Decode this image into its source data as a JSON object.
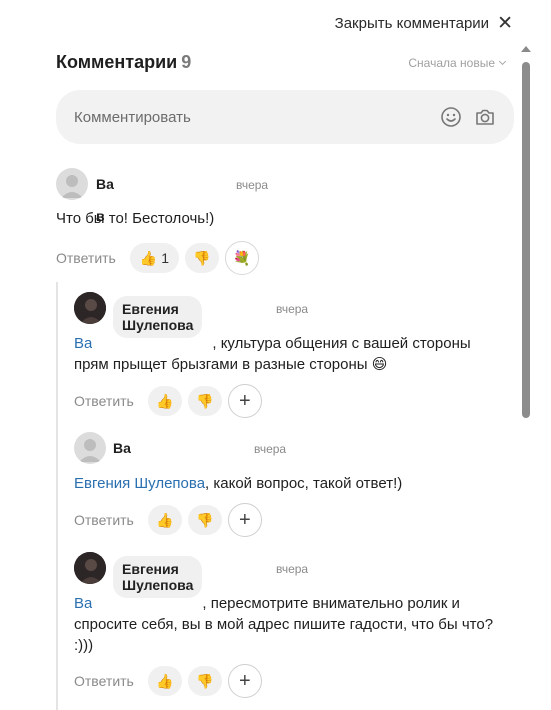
{
  "close_label": "Закрыть комментарии",
  "header": {
    "title": "Комментарии",
    "count": "9",
    "sort_label": "Сначала новые"
  },
  "composer": {
    "placeholder": "Комментировать"
  },
  "comments": [
    {
      "author": "Ва",
      "author_tail": "в",
      "time": "вчера",
      "text": "Что бы то! Бестолочь!)",
      "reply": "Ответить",
      "like_count": "1"
    },
    {
      "author": "Евгения Шулепова",
      "time": "вчера",
      "mention": "Ва",
      "text": ", культура общения с вашей стороны прям прыщет брызгами в разные стороны 😄",
      "reply": "Ответить"
    },
    {
      "author": "Ва",
      "time": "вчера",
      "mention": "Евгения Шулепова",
      "text": ", какой вопрос, такой ответ!)",
      "reply": "Ответить"
    },
    {
      "author": "Евгения Шулепова",
      "time": "вчера",
      "mention": "Ва",
      "text": ", пересмотрите внимательно ролик и спросите себя, вы в мой адрес пишите гадости, что бы что? :)))",
      "reply": "Ответить"
    }
  ],
  "colors": {
    "accent_link": "#2a6fb0",
    "pill_bg": "#f0f0f0",
    "muted": "#8a8a8a"
  }
}
